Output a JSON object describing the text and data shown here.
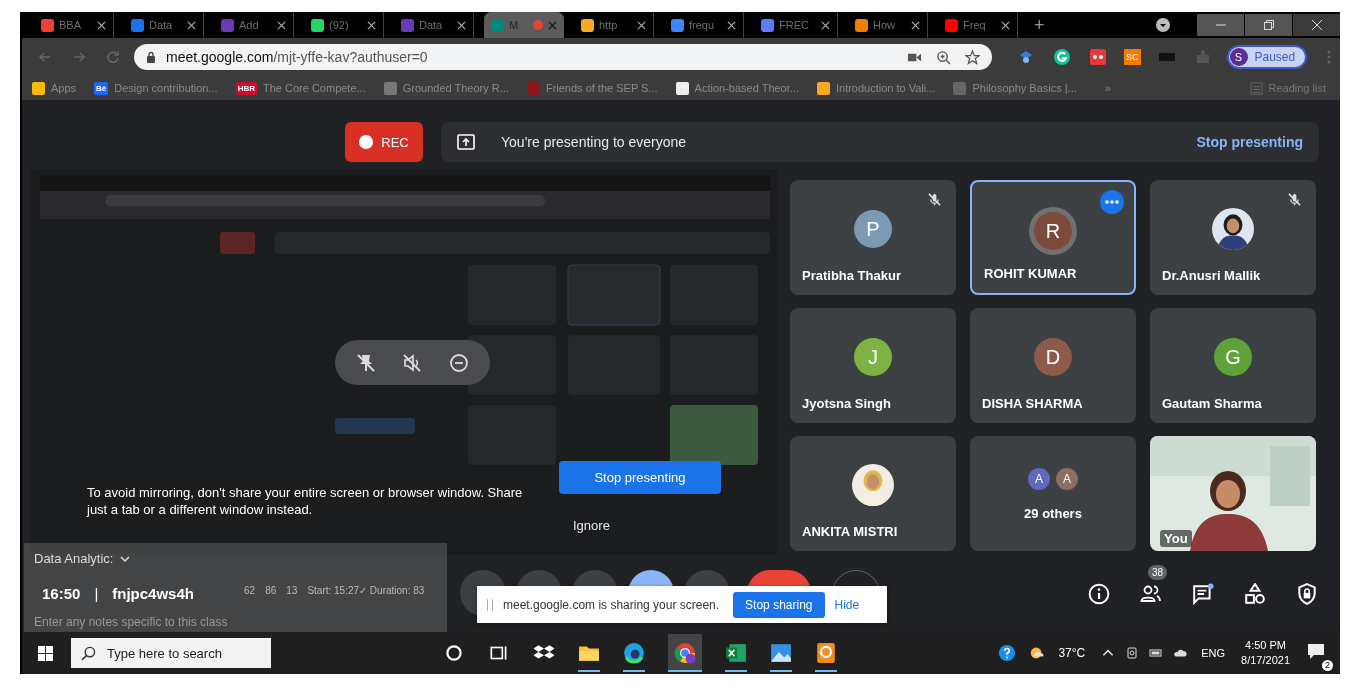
{
  "browser": {
    "tabs": [
      {
        "title": "BBA",
        "color": "#ea4335",
        "selected": false
      },
      {
        "title": "Data",
        "color": "#1a73e8",
        "selected": false
      },
      {
        "title": "Add",
        "color": "#673ab7",
        "selected": false
      },
      {
        "title": "(92)",
        "color": "#25d366",
        "selected": false
      },
      {
        "title": "Data",
        "color": "#673ab7",
        "selected": false
      },
      {
        "title": "M",
        "color": "#00897b",
        "selected": true,
        "recording": true
      },
      {
        "title": "http",
        "color": "#f9a825",
        "selected": false
      },
      {
        "title": "frequ",
        "color": "#4285f4",
        "selected": false
      },
      {
        "title": "FREC",
        "color": "#5c7cfa",
        "selected": false
      },
      {
        "title": "How",
        "color": "#f57c00",
        "selected": false
      },
      {
        "title": "Freq",
        "color": "#ff0000",
        "selected": false
      }
    ],
    "new_tab": "+",
    "url_host": "meet.google.com",
    "url_path": "/mjt-yffe-kav?authuser=0",
    "extension_label": "SC",
    "profile": {
      "initial": "S",
      "status": "Paused"
    },
    "bookmarks": [
      {
        "title": "Apps",
        "color": "#fbbc04"
      },
      {
        "title": "Design contribution...",
        "icon_text": "Bē",
        "color": "#1769ff"
      },
      {
        "title": "The Core Compete...",
        "icon_text": "HBR",
        "color": "#c8102e"
      },
      {
        "title": "Grounded Theory R...",
        "color": "#777777"
      },
      {
        "title": "Friends of the SEP S...",
        "color": "#8c1515"
      },
      {
        "title": "Action-based Theor...",
        "color": "#eeeeee"
      },
      {
        "title": "Introduction to Vali...",
        "color": "#f9a825"
      },
      {
        "title": "Philosophy Basics |...",
        "color": "#666666"
      }
    ],
    "more": "»",
    "reading_list": "Reading list"
  },
  "meet": {
    "rec": "REC",
    "banner": "You're presenting to everyone",
    "stop_presenting": "Stop presenting",
    "tiles": [
      {
        "kind": "letter",
        "name": "Pratibha Thakur",
        "initial": "P",
        "color": "#7b9ab4",
        "muted": true,
        "speaking": false
      },
      {
        "kind": "letter",
        "name": "ROHIT KUMAR",
        "initial": "R",
        "color": "#7b4a3c",
        "muted": false,
        "speaking": true
      },
      {
        "name": "Dr.Anusri Mallik",
        "muted": true,
        "speaking": false
      },
      {
        "kind": "letter",
        "name": "Jyotsna Singh",
        "initial": "J",
        "color": "#7cb342",
        "muted": false,
        "speaking": false
      },
      {
        "kind": "letter",
        "name": "DISHA SHARMA",
        "initial": "D",
        "color": "#8d5a4c",
        "muted": false,
        "speaking": false
      },
      {
        "kind": "letter",
        "name": "Gautam Sharma",
        "initial": "G",
        "color": "#5fa237",
        "muted": false,
        "speaking": false
      },
      {
        "name": "ANKITA MISTRI",
        "muted": false,
        "speaking": false
      },
      {
        "kind": "others",
        "name": "29 others",
        "avatars": [
          {
            "initial": "A",
            "color": "#5c6bc0"
          },
          {
            "initial": "A",
            "color": "#8d6e63"
          }
        ],
        "muted": false,
        "speaking": false
      },
      {
        "kind": "video",
        "name": "You",
        "muted": false,
        "speaking": false
      }
    ],
    "mirror_notice": "To avoid mirroring, don't share your entire screen or browser window. Share just a tab or a different window instead.",
    "notice_button": "Stop presenting",
    "notice_ignore": "Ignore",
    "time": "16:50",
    "separator": "|",
    "code": "fnjpc4ws4h",
    "people_count": "38",
    "sharing": {
      "text": "meet.google.com is sharing your screen.",
      "stop": "Stop sharing",
      "hide": "Hide"
    },
    "extension": {
      "title": "Data Analytic:",
      "stats": [
        "62",
        "86",
        "13"
      ],
      "session": "Start: 15:27✓ Duration: 83",
      "notes_placeholder": "Enter any notes specific to this class"
    }
  },
  "taskbar": {
    "search_placeholder": "Type here to search",
    "temperature": "37°C",
    "language": "ENG",
    "time": "4:50 PM",
    "date": "8/17/2021",
    "notifications": "2"
  }
}
